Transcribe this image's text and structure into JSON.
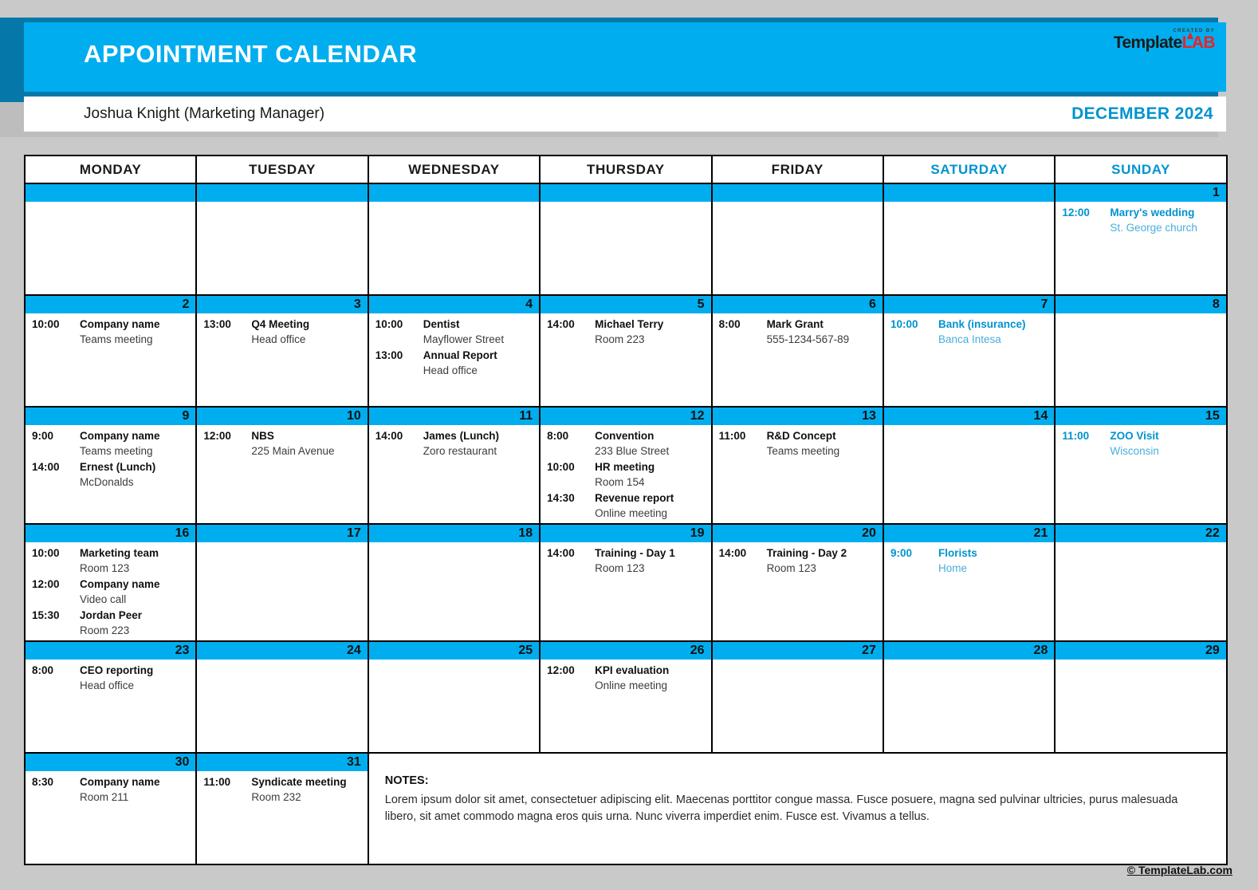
{
  "header": {
    "title": "APPOINTMENT CALENDAR",
    "owner": "Joshua Knight (Marketing Manager)",
    "month": "DECEMBER 2024",
    "logo": {
      "created_by": "CREATED BY",
      "name_dark": "Template",
      "name_red": "LAB"
    },
    "accent_color": "#00AEEF",
    "accent_dark_color": "#0578A9",
    "weekend_color": "#0093D0"
  },
  "day_headers": [
    {
      "label": "MONDAY",
      "weekend": false
    },
    {
      "label": "TUESDAY",
      "weekend": false
    },
    {
      "label": "WEDNESDAY",
      "weekend": false
    },
    {
      "label": "THURSDAY",
      "weekend": false
    },
    {
      "label": "FRIDAY",
      "weekend": false
    },
    {
      "label": "SATURDAY",
      "weekend": true
    },
    {
      "label": "SUNDAY",
      "weekend": true
    }
  ],
  "weeks": [
    [
      {
        "day": "",
        "events": []
      },
      {
        "day": "",
        "events": []
      },
      {
        "day": "",
        "events": []
      },
      {
        "day": "",
        "events": []
      },
      {
        "day": "",
        "events": []
      },
      {
        "day": "",
        "events": []
      },
      {
        "day": "1",
        "weekend": true,
        "events": [
          {
            "time": "12:00",
            "title": "Marry's wedding",
            "sub": "St. George church"
          }
        ]
      }
    ],
    [
      {
        "day": "2",
        "events": [
          {
            "time": "10:00",
            "title": "Company name",
            "sub": "Teams meeting"
          }
        ]
      },
      {
        "day": "3",
        "events": [
          {
            "time": "13:00",
            "title": "Q4 Meeting",
            "sub": "Head office"
          }
        ]
      },
      {
        "day": "4",
        "events": [
          {
            "time": "10:00",
            "title": "Dentist",
            "sub": "Mayflower Street"
          },
          {
            "time": "13:00",
            "title": "Annual Report",
            "sub": "Head office"
          }
        ]
      },
      {
        "day": "5",
        "events": [
          {
            "time": "14:00",
            "title": "Michael Terry",
            "sub": "Room 223"
          }
        ]
      },
      {
        "day": "6",
        "events": [
          {
            "time": "8:00",
            "title": "Mark Grant",
            "sub": "555-1234-567-89"
          }
        ]
      },
      {
        "day": "7",
        "weekend": true,
        "events": [
          {
            "time": "10:00",
            "title": "Bank (insurance)",
            "sub": "Banca Intesa"
          }
        ]
      },
      {
        "day": "8",
        "weekend": true,
        "events": []
      }
    ],
    [
      {
        "day": "9",
        "events": [
          {
            "time": "9:00",
            "title": "Company name",
            "sub": "Teams meeting"
          },
          {
            "time": "14:00",
            "title": "Ernest (Lunch)",
            "sub": "McDonalds"
          }
        ]
      },
      {
        "day": "10",
        "events": [
          {
            "time": "12:00",
            "title": "NBS",
            "sub": "225 Main Avenue"
          }
        ]
      },
      {
        "day": "11",
        "events": [
          {
            "time": "14:00",
            "title": "James (Lunch)",
            "sub": "Zoro restaurant"
          }
        ]
      },
      {
        "day": "12",
        "events": [
          {
            "time": "8:00",
            "title": "Convention",
            "sub": "233 Blue Street"
          },
          {
            "time": "10:00",
            "title": "HR meeting",
            "sub": "Room 154"
          },
          {
            "time": "14:30",
            "title": "Revenue report",
            "sub": "Online meeting"
          }
        ]
      },
      {
        "day": "13",
        "events": [
          {
            "time": "11:00",
            "title": "R&D Concept",
            "sub": "Teams meeting"
          }
        ]
      },
      {
        "day": "14",
        "weekend": true,
        "events": []
      },
      {
        "day": "15",
        "weekend": true,
        "events": [
          {
            "time": "11:00",
            "title": "ZOO Visit",
            "sub": "Wisconsin"
          }
        ]
      }
    ],
    [
      {
        "day": "16",
        "events": [
          {
            "time": "10:00",
            "title": "Marketing team",
            "sub": "Room 123"
          },
          {
            "time": "12:00",
            "title": "Company name",
            "sub": "Video call"
          },
          {
            "time": "15:30",
            "title": "Jordan Peer",
            "sub": "Room 223"
          }
        ]
      },
      {
        "day": "17",
        "events": []
      },
      {
        "day": "18",
        "events": []
      },
      {
        "day": "19",
        "events": [
          {
            "time": "14:00",
            "title": "Training - Day 1",
            "sub": "Room 123"
          }
        ]
      },
      {
        "day": "20",
        "events": [
          {
            "time": "14:00",
            "title": "Training - Day 2",
            "sub": "Room 123"
          }
        ]
      },
      {
        "day": "21",
        "weekend": true,
        "events": [
          {
            "time": "9:00",
            "title": "Florists",
            "sub": "Home"
          }
        ]
      },
      {
        "day": "22",
        "weekend": true,
        "events": []
      }
    ],
    [
      {
        "day": "23",
        "events": [
          {
            "time": "8:00",
            "title": "CEO reporting",
            "sub": "Head office"
          }
        ]
      },
      {
        "day": "24",
        "events": []
      },
      {
        "day": "25",
        "events": []
      },
      {
        "day": "26",
        "events": [
          {
            "time": "12:00",
            "title": "KPI evaluation",
            "sub": "Online meeting"
          }
        ]
      },
      {
        "day": "27",
        "events": []
      },
      {
        "day": "28",
        "weekend": true,
        "events": []
      },
      {
        "day": "29",
        "weekend": true,
        "events": []
      }
    ],
    [
      {
        "day": "30",
        "events": [
          {
            "time": "8:30",
            "title": "Company name",
            "sub": "Room 211"
          }
        ]
      },
      {
        "day": "31",
        "events": [
          {
            "time": "11:00",
            "title": "Syndicate meeting",
            "sub": "Room 232"
          }
        ]
      }
    ]
  ],
  "notes": {
    "title": "NOTES:",
    "body": "Lorem ipsum dolor sit amet, consectetuer adipiscing elit. Maecenas porttitor congue massa. Fusce posuere, magna sed pulvinar ultricies, purus malesuada libero, sit amet commodo magna eros quis urna. Nunc viverra imperdiet enim. Fusce est. Vivamus a tellus."
  },
  "footer": {
    "copyright": "© TemplateLab.com"
  }
}
